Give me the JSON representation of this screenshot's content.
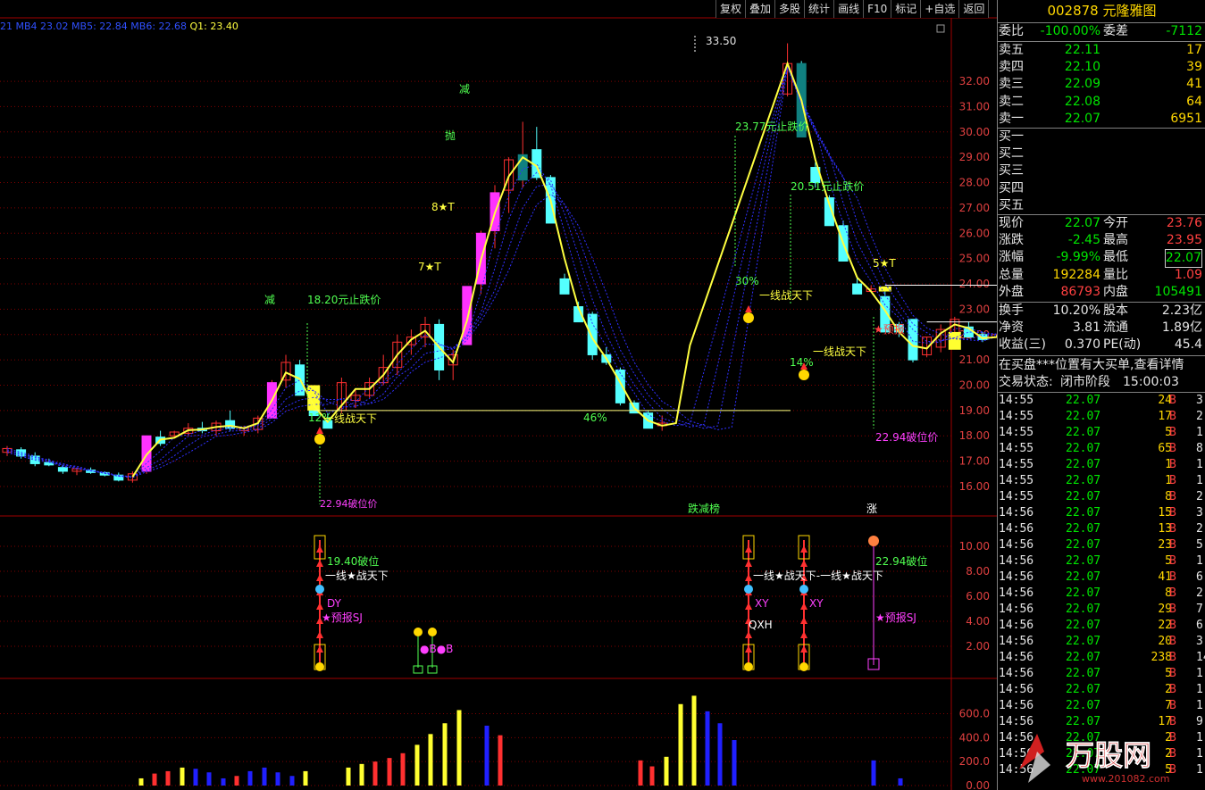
{
  "toolbar": [
    "复权",
    "叠加",
    "多股",
    "统计",
    "画线",
    "F10",
    "标记",
    "+自选",
    "返回"
  ],
  "ma_header": {
    "l0": "21",
    "l1": "MB4",
    "v1": "23.02",
    "l2": "MB5:",
    "v2": "22.84",
    "l3": "MB6:",
    "v3": "22.68",
    "l4": "Q1:",
    "v4": "23.40"
  },
  "stock": {
    "code": "002878",
    "name": "元隆雅图"
  },
  "order_ratio": {
    "l": "委比",
    "v": "-100.00%",
    "l2": "委差",
    "v2": "-7112"
  },
  "sells": [
    {
      "label": "卖五",
      "price": "22.11",
      "vol": "17"
    },
    {
      "label": "卖四",
      "price": "22.10",
      "vol": "39"
    },
    {
      "label": "卖三",
      "price": "22.09",
      "vol": "41"
    },
    {
      "label": "卖二",
      "price": "22.08",
      "vol": "64"
    },
    {
      "label": "卖一",
      "price": "22.07",
      "vol": "6951"
    }
  ],
  "buys": [
    "买一",
    "买二",
    "买三",
    "买四",
    "买五"
  ],
  "quote": [
    {
      "l1": "现价",
      "v1": "22.07",
      "c1": "green",
      "l2": "今开",
      "v2": "23.76",
      "c2": "red"
    },
    {
      "l1": "涨跌",
      "v1": "-2.45",
      "c1": "green",
      "l2": "最高",
      "v2": "23.95",
      "c2": "red"
    },
    {
      "l1": "涨幅",
      "v1": "-9.99%",
      "c1": "green",
      "l2": "最低",
      "v2": "22.07",
      "c2": "green"
    },
    {
      "l1": "总量",
      "v1": "192284",
      "c1": "yellow",
      "l2": "量比",
      "v2": "1.09",
      "c2": "red"
    },
    {
      "l1": "外盘",
      "v1": "86793",
      "c1": "red",
      "l2": "内盘",
      "v2": "105491",
      "c2": "green"
    }
  ],
  "finance": [
    {
      "l1": "换手",
      "v1": "10.20%",
      "l2": "股本",
      "v2": "2.23亿"
    },
    {
      "l1": "净资",
      "v1": "3.81",
      "l2": "流通",
      "v2": "1.89亿"
    },
    {
      "l1": "收益(三)",
      "v1": "0.370",
      "l2": "PE(动)",
      "v2": "45.4"
    }
  ],
  "notice": "在买盘***位置有大买单,查看详情",
  "status": {
    "l": "交易状态:",
    "v": "闭市阶段",
    "t": "15:00:03"
  },
  "ticks": [
    {
      "t": "14:55",
      "p": "22.07",
      "v": "24",
      "s": "B",
      "n": "3"
    },
    {
      "t": "14:55",
      "p": "22.07",
      "v": "17",
      "s": "B",
      "n": "2"
    },
    {
      "t": "14:55",
      "p": "22.07",
      "v": "5",
      "s": "B",
      "n": "1"
    },
    {
      "t": "14:55",
      "p": "22.07",
      "v": "65",
      "s": "B",
      "n": "8"
    },
    {
      "t": "14:55",
      "p": "22.07",
      "v": "1",
      "s": "B",
      "n": "1"
    },
    {
      "t": "14:55",
      "p": "22.07",
      "v": "1",
      "s": "B",
      "n": "1"
    },
    {
      "t": "14:55",
      "p": "22.07",
      "v": "8",
      "s": "B",
      "n": "2"
    },
    {
      "t": "14:56",
      "p": "22.07",
      "v": "15",
      "s": "B",
      "n": "3"
    },
    {
      "t": "14:56",
      "p": "22.07",
      "v": "13",
      "s": "B",
      "n": "2"
    },
    {
      "t": "14:56",
      "p": "22.07",
      "v": "23",
      "s": "B",
      "n": "5"
    },
    {
      "t": "14:56",
      "p": "22.07",
      "v": "5",
      "s": "B",
      "n": "1"
    },
    {
      "t": "14:56",
      "p": "22.07",
      "v": "41",
      "s": "B",
      "n": "6"
    },
    {
      "t": "14:56",
      "p": "22.07",
      "v": "8",
      "s": "B",
      "n": "2"
    },
    {
      "t": "14:56",
      "p": "22.07",
      "v": "29",
      "s": "B",
      "n": "7"
    },
    {
      "t": "14:56",
      "p": "22.07",
      "v": "22",
      "s": "B",
      "n": "6"
    },
    {
      "t": "14:56",
      "p": "22.07",
      "v": "20",
      "s": "B",
      "n": "3"
    },
    {
      "t": "14:56",
      "p": "22.07",
      "v": "238",
      "s": "B",
      "n": "14"
    },
    {
      "t": "14:56",
      "p": "22.07",
      "v": "5",
      "s": "B",
      "n": "1"
    },
    {
      "t": "14:56",
      "p": "22.07",
      "v": "2",
      "s": "B",
      "n": "1"
    },
    {
      "t": "14:56",
      "p": "22.07",
      "v": "7",
      "s": "B",
      "n": "1"
    },
    {
      "t": "14:56",
      "p": "22.07",
      "v": "17",
      "s": "B",
      "n": "9"
    },
    {
      "t": "14:56",
      "p": "22.07",
      "v": "2",
      "s": "B",
      "n": "1"
    },
    {
      "t": "14:56",
      "p": "22.07",
      "v": "2",
      "s": "B",
      "n": "1"
    },
    {
      "t": "14:56",
      "p": "22.07",
      "v": "5",
      "s": "B",
      "n": "1"
    }
  ],
  "watermark": {
    "brand": "万股网",
    "url": "www.201082.com"
  },
  "colors": {
    "up": "#ff3030",
    "down": "#54ffff",
    "ma": "#ffff40",
    "bull": "#ff33ff",
    "band": "#3030ff",
    "grid": "#800000"
  },
  "chart_data": [
    {
      "type": "candlestick",
      "name": "price",
      "yticks": [
        32,
        31,
        30,
        29,
        28,
        27,
        26,
        25,
        24,
        23,
        22,
        21,
        20,
        19,
        18,
        17,
        16
      ],
      "ylim": [
        15.4,
        33.8
      ],
      "ylabels": [
        "32.00",
        "31.00",
        "30.00",
        "29.00",
        "28.00",
        "27.00",
        "26.00",
        "25.00",
        "24.00",
        "23.00",
        "22.00",
        "21.00",
        "20.00",
        "19.00",
        "18.00",
        "17.00",
        "16.00"
      ],
      "candles": [
        [
          17.35,
          17.6,
          17.2,
          17.5
        ],
        [
          17.45,
          17.55,
          17.1,
          17.2
        ],
        [
          17.2,
          17.35,
          16.8,
          16.9
        ],
        [
          16.95,
          17.1,
          16.8,
          16.85
        ],
        [
          16.75,
          16.85,
          16.5,
          16.6
        ],
        [
          16.6,
          16.75,
          16.45,
          16.7
        ],
        [
          16.65,
          16.75,
          16.5,
          16.55
        ],
        [
          16.55,
          16.6,
          16.4,
          16.45
        ],
        [
          16.45,
          16.55,
          16.2,
          16.25
        ],
        [
          16.25,
          16.6,
          16.15,
          16.5
        ],
        [
          16.6,
          18.0,
          16.5,
          18.0
        ],
        [
          17.95,
          18.2,
          17.6,
          17.7
        ],
        [
          18.0,
          18.2,
          17.9,
          18.15
        ],
        [
          18.1,
          18.5,
          18.0,
          18.3
        ],
        [
          18.3,
          18.55,
          18.1,
          18.2
        ],
        [
          18.2,
          18.6,
          18.0,
          18.5
        ],
        [
          18.6,
          19.0,
          18.2,
          18.3
        ],
        [
          18.2,
          18.4,
          18.0,
          18.3
        ],
        [
          18.25,
          18.8,
          18.1,
          18.7
        ],
        [
          18.7,
          20.2,
          18.7,
          20.1
        ],
        [
          20.2,
          21.2,
          19.9,
          20.9
        ],
        [
          20.8,
          21.0,
          19.8,
          19.6
        ],
        [
          19.0,
          19.4,
          18.8,
          18.8
        ],
        [
          18.6,
          18.9,
          18.3,
          18.3
        ],
        [
          19.0,
          20.3,
          18.9,
          20.1
        ],
        [
          19.4,
          19.8,
          19.1,
          19.6
        ],
        [
          19.6,
          20.3,
          19.5,
          20.1
        ],
        [
          20.1,
          21.2,
          20.0,
          20.7
        ],
        [
          20.7,
          22.0,
          20.4,
          21.7
        ],
        [
          21.6,
          22.2,
          21.2,
          21.9
        ],
        [
          21.9,
          22.7,
          21.5,
          22.4
        ],
        [
          22.4,
          22.6,
          20.2,
          20.6
        ],
        [
          20.8,
          21.4,
          20.2,
          21.2
        ],
        [
          21.6,
          23.9,
          21.6,
          23.9
        ],
        [
          24.0,
          26.1,
          23.6,
          26.0
        ],
        [
          26.1,
          27.9,
          25.4,
          27.6
        ],
        [
          27.7,
          29.0,
          26.8,
          28.9
        ],
        [
          28.1,
          30.4,
          27.8,
          29.1
        ],
        [
          29.3,
          30.2,
          28.1,
          28.2
        ],
        [
          28.2,
          28.3,
          26.4,
          26.4
        ],
        [
          24.2,
          24.4,
          23.6,
          23.6
        ],
        [
          23.1,
          23.3,
          22.5,
          22.5
        ],
        [
          22.8,
          22.9,
          21.0,
          21.2
        ],
        [
          21.2,
          21.5,
          20.8,
          20.9
        ],
        [
          20.6,
          20.7,
          19.2,
          19.3
        ],
        [
          19.3,
          19.4,
          18.9,
          18.9
        ],
        [
          18.9,
          19.0,
          18.3,
          18.3
        ],
        [
          18.4,
          18.8,
          18.2,
          18.5
        ],
        [
          null,
          null,
          null,
          null
        ],
        [
          null,
          null,
          null,
          null
        ],
        [
          null,
          null,
          null,
          null
        ],
        [
          null,
          null,
          null,
          null
        ],
        [
          null,
          null,
          null,
          null
        ],
        [
          null,
          null,
          null,
          null
        ],
        [
          null,
          null,
          null,
          null
        ],
        [
          null,
          null,
          null,
          null
        ],
        [
          31.5,
          33.5,
          31.4,
          32.7
        ],
        [
          32.7,
          32.8,
          29.8,
          29.8
        ],
        [
          28.6,
          28.8,
          27.8,
          28.0
        ],
        [
          27.4,
          27.5,
          26.4,
          26.3
        ],
        [
          26.3,
          26.5,
          25.0,
          24.9
        ],
        [
          24.0,
          24.3,
          23.6,
          23.6
        ],
        [
          23.7,
          23.95,
          23.7,
          23.8
        ],
        [
          23.5,
          23.7,
          22.1,
          22.1
        ],
        [
          22.4,
          22.5,
          21.9,
          22.1
        ],
        [
          22.6,
          22.6,
          20.9,
          21.0
        ],
        [
          21.2,
          21.9,
          21.1,
          21.9
        ],
        [
          21.5,
          22.4,
          21.3,
          22.2
        ],
        [
          21.8,
          22.7,
          21.7,
          22.6
        ],
        [
          22.3,
          22.5,
          21.9,
          21.9
        ],
        [
          22.0,
          22.1,
          21.7,
          21.8
        ],
        [
          21.9,
          22.0,
          21.9,
          22.0
        ],
        [
          22.0,
          24.0,
          21.9,
          24.0
        ],
        [
          23.76,
          23.95,
          22.07,
          22.07
        ]
      ],
      "annotations": [
        "18.20元止跌价",
        "23.77元止跌价",
        "20.51元止跌价",
        "22.94破位价",
        "12%",
        "46%",
        "30%",
        "14%",
        "33.50",
        "减",
        "抛",
        "8★T",
        "7★T",
        "5★T",
        "一线战天下",
        "一线战天下",
        "★预报",
        "跌减榜",
        "涨"
      ]
    },
    {
      "type": "bar",
      "name": "signal",
      "yticks": [
        10,
        8,
        6,
        4,
        2
      ],
      "ylabels": [
        "10.00",
        "8.00",
        "6.00",
        "4.00",
        "2.00"
      ],
      "ylim": [
        0,
        11
      ],
      "texts": [
        "19.40破位",
        "一线★战天下",
        "DY",
        "★预报SJ",
        "●B●B",
        "XY",
        "QXH",
        "一线★战天下-一线★战天下",
        "XY",
        "22.94破位",
        "★预报SJ"
      ]
    },
    {
      "type": "bar",
      "name": "volume",
      "yticks": [
        600,
        400,
        200,
        0
      ],
      "ylabels": [
        "600.0",
        "400.0",
        "200.0",
        "0.00"
      ],
      "ylim": [
        0,
        820
      ],
      "values": [
        60,
        100,
        120,
        150,
        140,
        110,
        60,
        80,
        120,
        150,
        110,
        80,
        120,
        150,
        180,
        200,
        230,
        270,
        340,
        430,
        520,
        630,
        500,
        420,
        210,
        160,
        240,
        680,
        750,
        620,
        520,
        380,
        210,
        60
      ],
      "colors": [
        "y",
        "r",
        "r",
        "y",
        "b",
        "b",
        "b",
        "r",
        "b",
        "b",
        "b",
        "b",
        "y",
        "y",
        "y",
        "r",
        "r",
        "r",
        "y",
        "y",
        "y",
        "y",
        "b",
        "r",
        "r",
        "r",
        "y",
        "y",
        "y",
        "b",
        "b",
        "b",
        "b",
        "b"
      ]
    }
  ]
}
